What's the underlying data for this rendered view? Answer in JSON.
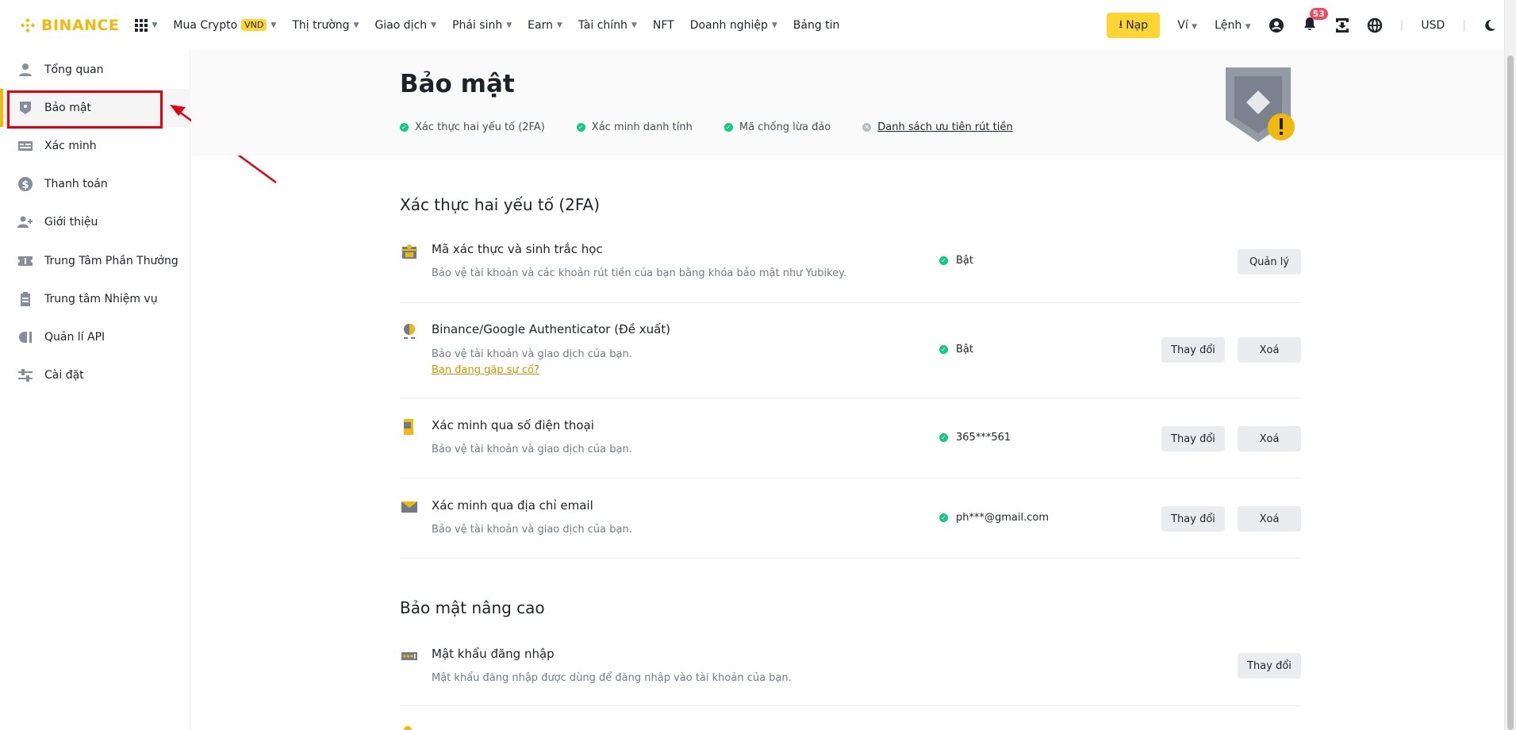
{
  "header": {
    "logo": "BINANCE",
    "nav": [
      {
        "label": "Mua Crypto",
        "badge": "VND",
        "caret": true
      },
      {
        "label": "Thị trường",
        "caret": true
      },
      {
        "label": "Giao dịch",
        "caret": true
      },
      {
        "label": "Phái sinh",
        "caret": true
      },
      {
        "label": "Earn",
        "caret": true
      },
      {
        "label": "Tài chính",
        "caret": true
      },
      {
        "label": "NFT",
        "caret": false
      },
      {
        "label": "Doanh nghiệp",
        "caret": true
      },
      {
        "label": "Bảng tin",
        "caret": false
      }
    ],
    "deposit": "Nạp",
    "wallet": "Ví",
    "orders": "Lệnh",
    "notifications": "53",
    "currency": "USD"
  },
  "sidebar": {
    "items": [
      {
        "label": "Tổng quan"
      },
      {
        "label": "Bảo mật",
        "active": true
      },
      {
        "label": "Xác minh"
      },
      {
        "label": "Thanh toán"
      },
      {
        "label": "Giới thiệu"
      },
      {
        "label": "Trung Tâm Phần Thưởng"
      },
      {
        "label": "Trung tâm Nhiệm vụ"
      },
      {
        "label": "Quản lí API"
      },
      {
        "label": "Cài đặt"
      }
    ]
  },
  "page": {
    "title": "Bảo mật",
    "status": [
      {
        "label": "Xác thực hai yếu tố (2FA)",
        "done": true
      },
      {
        "label": "Xác minh danh tính",
        "done": true
      },
      {
        "label": "Mã chống lừa đảo",
        "done": true
      },
      {
        "label": "Danh sách ưu tiên rút tiền",
        "done": false
      }
    ]
  },
  "twofa": {
    "title": "Xác thực hai yếu tố (2FA)",
    "rows": [
      {
        "title": "Mã xác thực và sinh trắc học",
        "desc": "Bảo vệ tài khoản và các khoản rút tiền của bạn bằng khóa bảo mật như Yubikey.",
        "status": "Bật",
        "buttons": [
          "Quản lý"
        ]
      },
      {
        "title": "Binance/Google Authenticator (Đề xuất)",
        "desc": "Bảo vệ tài khoản và giao dịch của bạn.",
        "link": "Bạn đang gặp sự cố?",
        "status": "Bật",
        "buttons": [
          "Thay đổi",
          "Xoá"
        ]
      },
      {
        "title": "Xác minh qua số điện thoại",
        "desc": "Bảo vệ tài khoản và giao dịch của bạn.",
        "status": "365***561",
        "buttons": [
          "Thay đổi",
          "Xoá"
        ]
      },
      {
        "title": "Xác minh qua địa chỉ email",
        "desc": "Bảo vệ tài khoản và giao dịch của bạn.",
        "status": "ph***@gmail.com",
        "buttons": [
          "Thay đổi",
          "Xoá"
        ]
      }
    ]
  },
  "advanced": {
    "title": "Bảo mật nâng cao",
    "rows": [
      {
        "title": "Mật khẩu đăng nhập",
        "desc": "Mật khẩu đăng nhập được dùng để đăng nhập vào tài khoản của bạn.",
        "buttons": [
          "Thay đổi"
        ]
      }
    ]
  },
  "colors": {
    "brand": "#F0B90B",
    "success": "#0ECB81",
    "annotation": "#E6000F"
  }
}
